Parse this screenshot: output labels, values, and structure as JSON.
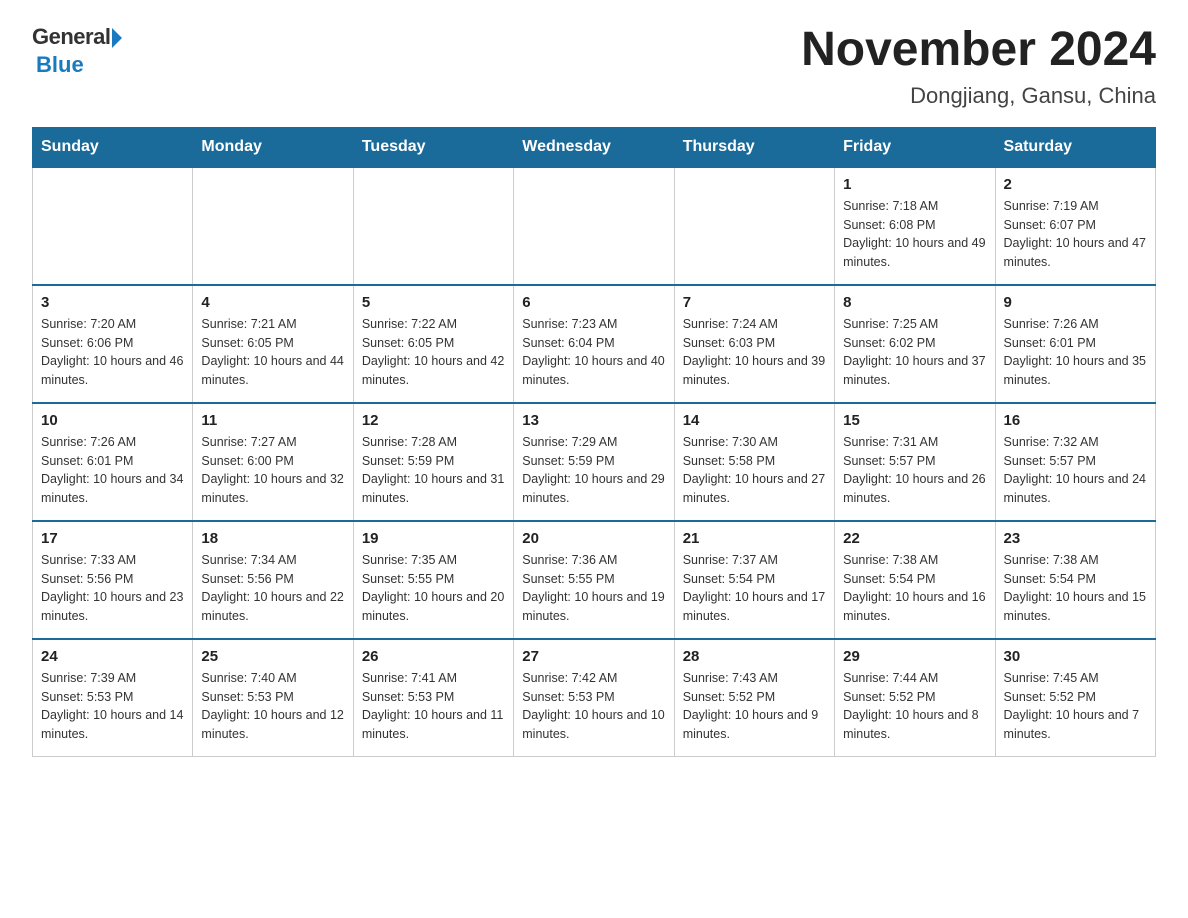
{
  "logo": {
    "general": "General",
    "blue": "Blue"
  },
  "title": {
    "month_year": "November 2024",
    "location": "Dongjiang, Gansu, China"
  },
  "days_of_week": [
    "Sunday",
    "Monday",
    "Tuesday",
    "Wednesday",
    "Thursday",
    "Friday",
    "Saturday"
  ],
  "weeks": [
    [
      {
        "day": "",
        "sunrise": "",
        "sunset": "",
        "daylight": ""
      },
      {
        "day": "",
        "sunrise": "",
        "sunset": "",
        "daylight": ""
      },
      {
        "day": "",
        "sunrise": "",
        "sunset": "",
        "daylight": ""
      },
      {
        "day": "",
        "sunrise": "",
        "sunset": "",
        "daylight": ""
      },
      {
        "day": "",
        "sunrise": "",
        "sunset": "",
        "daylight": ""
      },
      {
        "day": "1",
        "sunrise": "Sunrise: 7:18 AM",
        "sunset": "Sunset: 6:08 PM",
        "daylight": "Daylight: 10 hours and 49 minutes."
      },
      {
        "day": "2",
        "sunrise": "Sunrise: 7:19 AM",
        "sunset": "Sunset: 6:07 PM",
        "daylight": "Daylight: 10 hours and 47 minutes."
      }
    ],
    [
      {
        "day": "3",
        "sunrise": "Sunrise: 7:20 AM",
        "sunset": "Sunset: 6:06 PM",
        "daylight": "Daylight: 10 hours and 46 minutes."
      },
      {
        "day": "4",
        "sunrise": "Sunrise: 7:21 AM",
        "sunset": "Sunset: 6:05 PM",
        "daylight": "Daylight: 10 hours and 44 minutes."
      },
      {
        "day": "5",
        "sunrise": "Sunrise: 7:22 AM",
        "sunset": "Sunset: 6:05 PM",
        "daylight": "Daylight: 10 hours and 42 minutes."
      },
      {
        "day": "6",
        "sunrise": "Sunrise: 7:23 AM",
        "sunset": "Sunset: 6:04 PM",
        "daylight": "Daylight: 10 hours and 40 minutes."
      },
      {
        "day": "7",
        "sunrise": "Sunrise: 7:24 AM",
        "sunset": "Sunset: 6:03 PM",
        "daylight": "Daylight: 10 hours and 39 minutes."
      },
      {
        "day": "8",
        "sunrise": "Sunrise: 7:25 AM",
        "sunset": "Sunset: 6:02 PM",
        "daylight": "Daylight: 10 hours and 37 minutes."
      },
      {
        "day": "9",
        "sunrise": "Sunrise: 7:26 AM",
        "sunset": "Sunset: 6:01 PM",
        "daylight": "Daylight: 10 hours and 35 minutes."
      }
    ],
    [
      {
        "day": "10",
        "sunrise": "Sunrise: 7:26 AM",
        "sunset": "Sunset: 6:01 PM",
        "daylight": "Daylight: 10 hours and 34 minutes."
      },
      {
        "day": "11",
        "sunrise": "Sunrise: 7:27 AM",
        "sunset": "Sunset: 6:00 PM",
        "daylight": "Daylight: 10 hours and 32 minutes."
      },
      {
        "day": "12",
        "sunrise": "Sunrise: 7:28 AM",
        "sunset": "Sunset: 5:59 PM",
        "daylight": "Daylight: 10 hours and 31 minutes."
      },
      {
        "day": "13",
        "sunrise": "Sunrise: 7:29 AM",
        "sunset": "Sunset: 5:59 PM",
        "daylight": "Daylight: 10 hours and 29 minutes."
      },
      {
        "day": "14",
        "sunrise": "Sunrise: 7:30 AM",
        "sunset": "Sunset: 5:58 PM",
        "daylight": "Daylight: 10 hours and 27 minutes."
      },
      {
        "day": "15",
        "sunrise": "Sunrise: 7:31 AM",
        "sunset": "Sunset: 5:57 PM",
        "daylight": "Daylight: 10 hours and 26 minutes."
      },
      {
        "day": "16",
        "sunrise": "Sunrise: 7:32 AM",
        "sunset": "Sunset: 5:57 PM",
        "daylight": "Daylight: 10 hours and 24 minutes."
      }
    ],
    [
      {
        "day": "17",
        "sunrise": "Sunrise: 7:33 AM",
        "sunset": "Sunset: 5:56 PM",
        "daylight": "Daylight: 10 hours and 23 minutes."
      },
      {
        "day": "18",
        "sunrise": "Sunrise: 7:34 AM",
        "sunset": "Sunset: 5:56 PM",
        "daylight": "Daylight: 10 hours and 22 minutes."
      },
      {
        "day": "19",
        "sunrise": "Sunrise: 7:35 AM",
        "sunset": "Sunset: 5:55 PM",
        "daylight": "Daylight: 10 hours and 20 minutes."
      },
      {
        "day": "20",
        "sunrise": "Sunrise: 7:36 AM",
        "sunset": "Sunset: 5:55 PM",
        "daylight": "Daylight: 10 hours and 19 minutes."
      },
      {
        "day": "21",
        "sunrise": "Sunrise: 7:37 AM",
        "sunset": "Sunset: 5:54 PM",
        "daylight": "Daylight: 10 hours and 17 minutes."
      },
      {
        "day": "22",
        "sunrise": "Sunrise: 7:38 AM",
        "sunset": "Sunset: 5:54 PM",
        "daylight": "Daylight: 10 hours and 16 minutes."
      },
      {
        "day": "23",
        "sunrise": "Sunrise: 7:38 AM",
        "sunset": "Sunset: 5:54 PM",
        "daylight": "Daylight: 10 hours and 15 minutes."
      }
    ],
    [
      {
        "day": "24",
        "sunrise": "Sunrise: 7:39 AM",
        "sunset": "Sunset: 5:53 PM",
        "daylight": "Daylight: 10 hours and 14 minutes."
      },
      {
        "day": "25",
        "sunrise": "Sunrise: 7:40 AM",
        "sunset": "Sunset: 5:53 PM",
        "daylight": "Daylight: 10 hours and 12 minutes."
      },
      {
        "day": "26",
        "sunrise": "Sunrise: 7:41 AM",
        "sunset": "Sunset: 5:53 PM",
        "daylight": "Daylight: 10 hours and 11 minutes."
      },
      {
        "day": "27",
        "sunrise": "Sunrise: 7:42 AM",
        "sunset": "Sunset: 5:53 PM",
        "daylight": "Daylight: 10 hours and 10 minutes."
      },
      {
        "day": "28",
        "sunrise": "Sunrise: 7:43 AM",
        "sunset": "Sunset: 5:52 PM",
        "daylight": "Daylight: 10 hours and 9 minutes."
      },
      {
        "day": "29",
        "sunrise": "Sunrise: 7:44 AM",
        "sunset": "Sunset: 5:52 PM",
        "daylight": "Daylight: 10 hours and 8 minutes."
      },
      {
        "day": "30",
        "sunrise": "Sunrise: 7:45 AM",
        "sunset": "Sunset: 5:52 PM",
        "daylight": "Daylight: 10 hours and 7 minutes."
      }
    ]
  ],
  "colors": {
    "header_bg": "#1a6b9a",
    "header_text": "#ffffff",
    "border": "#1a6b9a"
  }
}
